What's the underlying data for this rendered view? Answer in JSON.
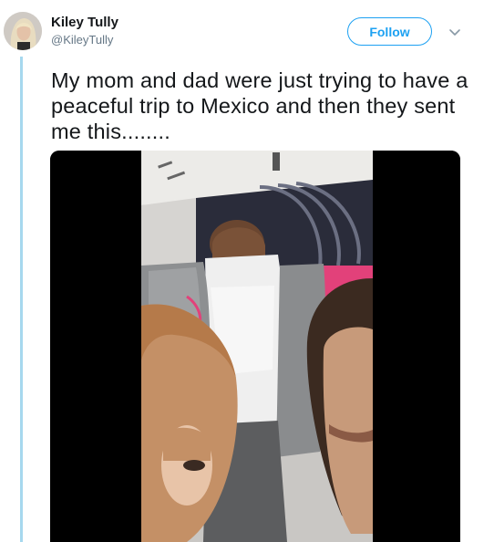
{
  "tweet": {
    "display_name": "Kiley Tully",
    "handle": "@KileyTully",
    "text": "My mom and dad were just trying to have a peaceful trip to Mexico and then they sent me this........",
    "follow_label": "Follow",
    "more_icon": "chevron-down-icon",
    "avatar_icon": "profile-photo"
  },
  "colors": {
    "accent": "#1da1f2",
    "thread_line": "#a6d8ee",
    "handle_gray": "#657786",
    "text": "#14171a"
  }
}
